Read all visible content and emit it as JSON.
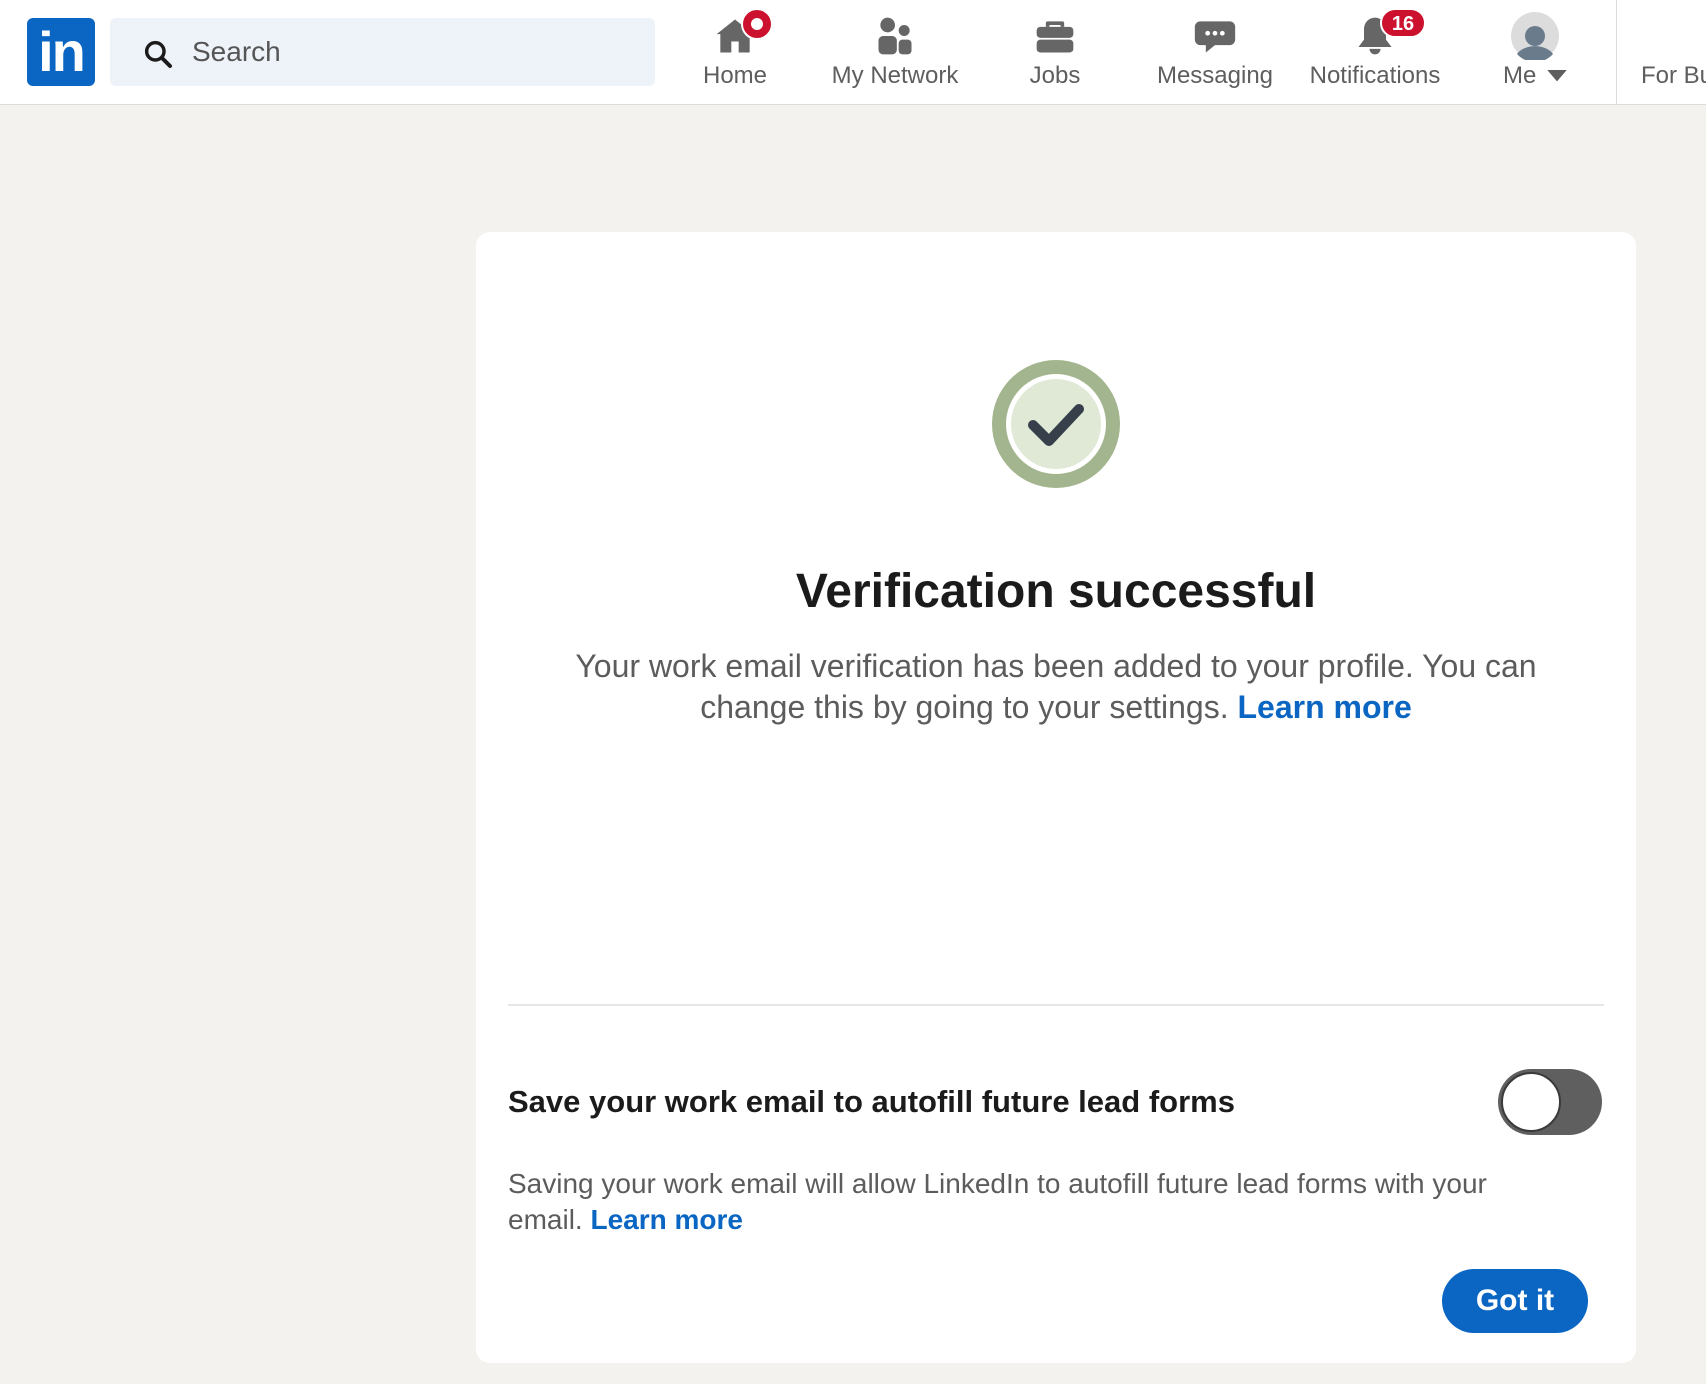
{
  "nav": {
    "logo_text": "in",
    "search_placeholder": "Search",
    "items": [
      {
        "label": "Home",
        "icon": "home-icon"
      },
      {
        "label": "My Network",
        "icon": "my-network-icon"
      },
      {
        "label": "Jobs",
        "icon": "jobs-icon"
      },
      {
        "label": "Messaging",
        "icon": "messaging-icon"
      },
      {
        "label": "Notifications",
        "icon": "notifications-icon",
        "badge": "16"
      },
      {
        "label": "Me",
        "icon": "avatar"
      }
    ],
    "for_business_label": "For Bu"
  },
  "card": {
    "title": "Verification successful",
    "description": "Your work email verification has been added to your profile. You can change this by going to your settings.",
    "learn_more": "Learn more",
    "autofill_title": "Save your work email to autofill future lead forms",
    "autofill_description": "Saving your work email will allow LinkedIn to autofill future lead forms with your email.",
    "autofill_learn_more": "Learn more",
    "autofill_enabled": false,
    "got_it_label": "Got it"
  },
  "colors": {
    "brand": "#0a66c2",
    "badge": "#cb112d",
    "success_ring": "#a3b58e",
    "success_fill": "#dfe9d6"
  }
}
